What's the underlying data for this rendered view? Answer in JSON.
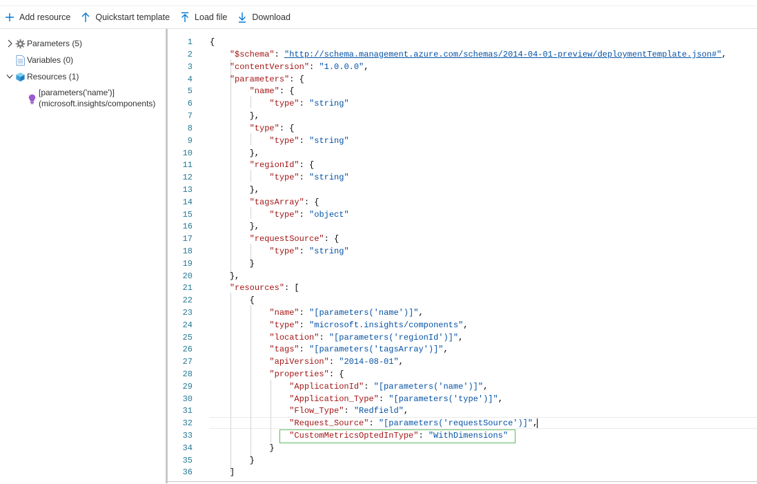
{
  "toolbar": {
    "add_resource": "Add resource",
    "quickstart_template": "Quickstart template",
    "load_file": "Load file",
    "download": "Download"
  },
  "tree": {
    "parameters": "Parameters (5)",
    "variables": "Variables (0)",
    "resources": "Resources (1)",
    "resource_item_line1": "[parameters('name')]",
    "resource_item_line2": "(microsoft.insights/components)"
  },
  "editor": {
    "line_numbers": [
      "1",
      "2",
      "3",
      "4",
      "5",
      "6",
      "7",
      "8",
      "9",
      "10",
      "11",
      "12",
      "13",
      "14",
      "15",
      "16",
      "17",
      "18",
      "19",
      "20",
      "21",
      "22",
      "23",
      "24",
      "25",
      "26",
      "27",
      "28",
      "29",
      "30",
      "31",
      "32",
      "33",
      "34",
      "35",
      "36"
    ],
    "code": {
      "l1": "{",
      "l2_key": "\"$schema\"",
      "l2_url": "\"http://schema.management.azure.com/schemas/2014-04-01-preview/deploymentTemplate.json#\"",
      "l3_key": "\"contentVersion\"",
      "l3_val": "\"1.0.0.0\"",
      "l4_key": "\"parameters\"",
      "l5_key": "\"name\"",
      "l6_key": "\"type\"",
      "l6_val": "\"string\"",
      "l7": "},",
      "l8_key": "\"type\"",
      "l9_key": "\"type\"",
      "l9_val": "\"string\"",
      "l10": "},",
      "l11_key": "\"regionId\"",
      "l12_key": "\"type\"",
      "l12_val": "\"string\"",
      "l13": "},",
      "l14_key": "\"tagsArray\"",
      "l15_key": "\"type\"",
      "l15_val": "\"object\"",
      "l16": "},",
      "l17_key": "\"requestSource\"",
      "l18_key": "\"type\"",
      "l18_val": "\"string\"",
      "l19": "}",
      "l20": "},",
      "l21_key": "\"resources\"",
      "l22": "{",
      "l23_key": "\"name\"",
      "l23_val": "\"[parameters('name')]\"",
      "l24_key": "\"type\"",
      "l24_val": "\"microsoft.insights/components\"",
      "l25_key": "\"location\"",
      "l25_val": "\"[parameters('regionId')]\"",
      "l26_key": "\"tags\"",
      "l26_val": "\"[parameters('tagsArray')]\"",
      "l27_key": "\"apiVersion\"",
      "l27_val": "\"2014-08-01\"",
      "l28_key": "\"properties\"",
      "l29_key": "\"ApplicationId\"",
      "l29_val": "\"[parameters('name')]\"",
      "l30_key": "\"Application_Type\"",
      "l30_val": "\"[parameters('type')]\"",
      "l31_key": "\"Flow_Type\"",
      "l31_val": "\"Redfield\"",
      "l32_key": "\"Request_Source\"",
      "l32_val": "\"[parameters('requestSource')]\"",
      "l33_key": "\"CustomMetricsOptedInType\"",
      "l33_val": "\"WithDimensions\"",
      "l34": "}",
      "l35": "}",
      "l36": "]"
    }
  },
  "colors": {
    "accent": "#0078d4",
    "json_key": "#a31515",
    "json_string": "#0451a5",
    "line_number": "#237893",
    "highlight_border": "#5cb85c"
  },
  "icons": {
    "add": "plus-icon",
    "quickstart": "arrow-up-icon",
    "load": "upload-icon",
    "download": "download-icon",
    "parameters": "gear-icon",
    "variables": "document-icon",
    "resources": "cube-icon",
    "resource_item": "lightbulb-icon"
  }
}
